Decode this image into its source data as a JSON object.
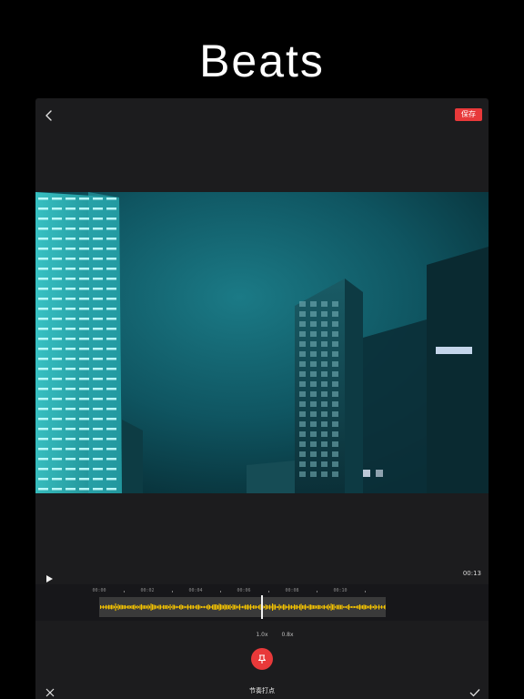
{
  "hero": {
    "title": "Beats"
  },
  "toolbar": {
    "save_label": "保存"
  },
  "player": {
    "duration": "00:13"
  },
  "timeline": {
    "ticks": [
      "00:00",
      "00:02",
      "00:04",
      "00:06",
      "00:08",
      "00:10"
    ],
    "waveform_color": "#f5c400"
  },
  "speeds": [
    "1.0x",
    "0.8x"
  ],
  "bottom": {
    "title": "节奏打点"
  },
  "colors": {
    "accent": "#e8393a",
    "panel": "#1c1c1e",
    "background": "#000000"
  },
  "icons": [
    "back-arrow-icon",
    "play-icon",
    "pin-icon",
    "close-icon",
    "check-icon"
  ]
}
